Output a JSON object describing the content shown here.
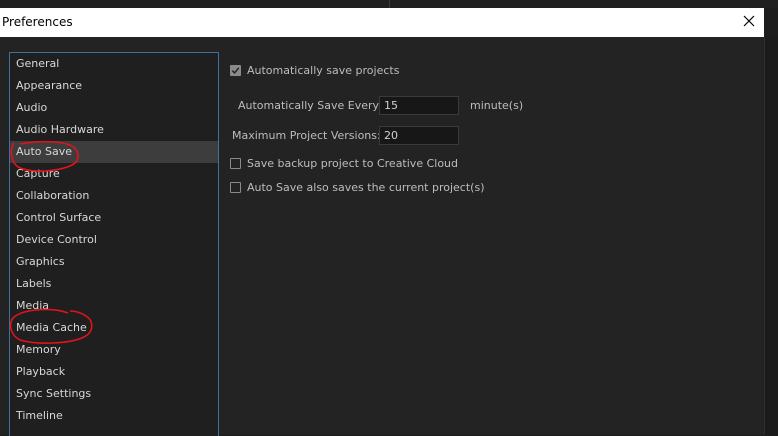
{
  "window": {
    "title": "Preferences"
  },
  "sidebar": {
    "items": [
      {
        "label": "General"
      },
      {
        "label": "Appearance"
      },
      {
        "label": "Audio"
      },
      {
        "label": "Audio Hardware"
      },
      {
        "label": "Auto Save",
        "selected": true,
        "annotated": true
      },
      {
        "label": "Capture"
      },
      {
        "label": "Collaboration"
      },
      {
        "label": "Control Surface"
      },
      {
        "label": "Device Control"
      },
      {
        "label": "Graphics"
      },
      {
        "label": "Labels"
      },
      {
        "label": "Media"
      },
      {
        "label": "Media Cache",
        "annotated": true
      },
      {
        "label": "Memory"
      },
      {
        "label": "Playback"
      },
      {
        "label": "Sync Settings"
      },
      {
        "label": "Timeline"
      }
    ]
  },
  "auto_save": {
    "auto_save_checkbox": {
      "label": "Automatically save projects",
      "checked": true
    },
    "save_every": {
      "label": "Automatically Save Every:",
      "value": "15",
      "unit": "minute(s)"
    },
    "max_versions": {
      "label": "Maximum Project Versions:",
      "value": "20"
    },
    "backup_cloud": {
      "label": "Save backup project to Creative Cloud",
      "checked": false
    },
    "save_current": {
      "label": "Auto Save also saves the current project(s)",
      "checked": false
    }
  },
  "colors": {
    "list_border": "#3f6fa1",
    "selection": "#3d3d3d",
    "annotation": "#e0141a"
  },
  "icons": {
    "close": "close-icon",
    "check": "checkmark-icon"
  }
}
